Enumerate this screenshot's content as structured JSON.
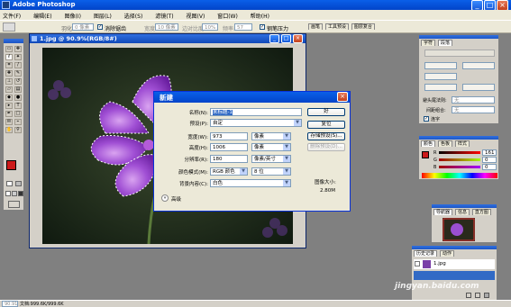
{
  "app": {
    "title": "Adobe Photoshop"
  },
  "menu": [
    "文件(F)",
    "编辑(E)",
    "图像(I)",
    "图层(L)",
    "选择(S)",
    "滤镜(T)",
    "视图(V)",
    "窗口(W)",
    "帮助(H)"
  ],
  "options_bar": {
    "feather_label": "羽化:",
    "feather_value": "0 像素",
    "antialias_label": "消除锯齿",
    "width_label": "宽度:",
    "width_value": "10 像素",
    "contrast_label": "边对比度:",
    "contrast_value": "10%",
    "frequency_label": "频率:",
    "frequency_value": "57",
    "pen_pressure_label": "钢笔压力",
    "palette_tabs": [
      "画笔",
      "工具预设",
      "图层复合"
    ]
  },
  "document": {
    "title": "1.jpg @ 90.9%(RGB/8#)"
  },
  "dialog": {
    "title": "新建",
    "name_label": "名称(N):",
    "name_value": "未标题-1",
    "preset_label": "预设(P):",
    "preset_value": "自定",
    "width_label": "宽度(W):",
    "width_value": "973",
    "width_unit": "像素",
    "height_label": "高度(H):",
    "height_value": "1006",
    "height_unit": "像素",
    "resolution_label": "分辨率(R):",
    "resolution_value": "180",
    "resolution_unit": "像素/英寸",
    "mode_label": "颜色模式(M):",
    "mode_value": "RGB 颜色",
    "bits_value": "8 位",
    "bg_label": "背景内容(C):",
    "bg_value": "白色",
    "advanced_label": "高级",
    "ok_label": "好",
    "reset_label": "复位",
    "save_preset_label": "存储预设(S)...",
    "delete_preset_label": "删除预设(D)...",
    "size_label": "图像大小:",
    "size_value": "2.80M"
  },
  "char_panel": {
    "tabs": [
      "字符",
      "段落"
    ],
    "hyphen_label": "避头尾法则:",
    "hyphen_value": "无",
    "spacing_label": "间距组合:",
    "spacing_value": "无",
    "hyphenate_label": "连字"
  },
  "color_panel": {
    "tabs": [
      "颜色",
      "色板",
      "样式"
    ],
    "channels": [
      {
        "label": "R",
        "value": "161"
      },
      {
        "label": "G",
        "value": "0"
      },
      {
        "label": "B",
        "value": "0"
      }
    ],
    "fg_color": "#cc1a1a"
  },
  "navigator_panel": {
    "tabs": [
      "导航器",
      "信息",
      "直方图"
    ]
  },
  "history_panel": {
    "tabs": [
      "历史记录",
      "动作"
    ],
    "item": "1.jpg"
  },
  "status": {
    "zoom": "90.91%",
    "doc_info": "文档:999.6K/999.6K"
  },
  "watermark": {
    "text": "jingyan.baidu.com"
  }
}
